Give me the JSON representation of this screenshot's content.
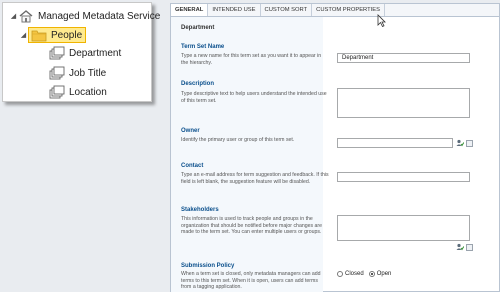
{
  "tree": {
    "root_label": "Managed Metadata Service",
    "term_set_label": "People",
    "terms": [
      {
        "label": "Department"
      },
      {
        "label": "Job Title"
      },
      {
        "label": "Location"
      }
    ]
  },
  "tabs": [
    {
      "label": "GENERAL",
      "active": true
    },
    {
      "label": "INTENDED USE",
      "active": false
    },
    {
      "label": "CUSTOM SORT",
      "active": false
    },
    {
      "label": "CUSTOM PROPERTIES",
      "active": false
    }
  ],
  "form": {
    "heading": "Department",
    "term_set_name": {
      "title": "Term Set Name",
      "description": "Type a new name for this term set as you want it to appear in the hierarchy.",
      "value": "Department"
    },
    "description": {
      "title": "Description",
      "description": "Type descriptive text to help users understand the intended use of this term set.",
      "value": ""
    },
    "owner": {
      "title": "Owner",
      "description": "Identify the primary user or group of this term set.",
      "value": ""
    },
    "contact": {
      "title": "Contact",
      "description": "Type an e-mail address for term suggestion and feedback. If this field is left blank, the suggestion feature will be disabled.",
      "value": ""
    },
    "stakeholders": {
      "title": "Stakeholders",
      "description": "This information is used to track people and groups in the organization that should be notified before major changes are made to the term set. You can enter multiple users or groups.",
      "value": ""
    },
    "submission_policy": {
      "title": "Submission Policy",
      "description": "When a term set is closed, only metadata managers can add terms to this term set. When it is open, users can add terms from a tagging application.",
      "options": [
        "Closed",
        "Open"
      ],
      "selected": "Open"
    }
  },
  "colors": {
    "section_title": "#0a4f8c",
    "selection_bg": "#ffea8f",
    "left_col_bg": "#f4f8fc"
  }
}
